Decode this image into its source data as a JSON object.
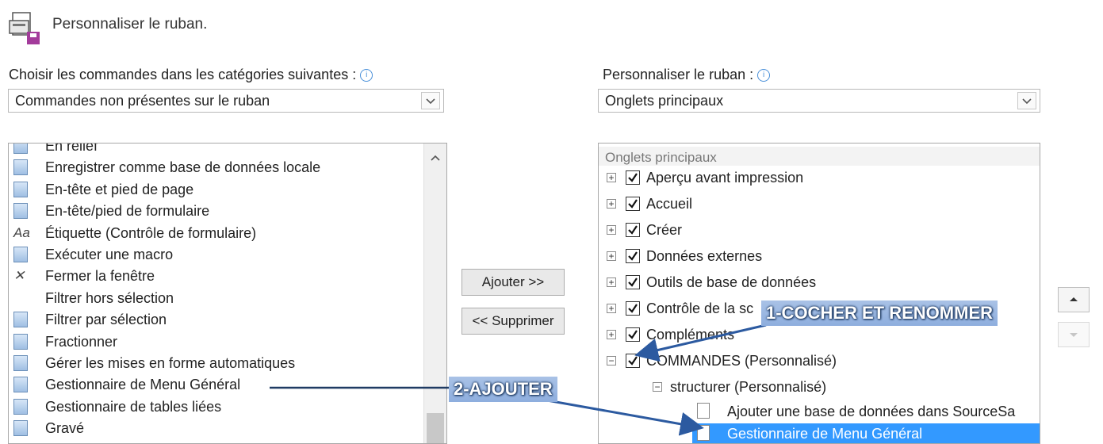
{
  "header": {
    "title": "Personnaliser le ruban."
  },
  "left": {
    "label": "Choisir les commandes dans les catégories suivantes :",
    "combo_value": "Commandes non présentes sur le ruban",
    "items": [
      {
        "label": "En relief",
        "icon": "emboss-icon"
      },
      {
        "label": "Enregistrer comme base de données locale",
        "icon": "save-local-db-icon"
      },
      {
        "label": "En-tête et pied de page",
        "icon": "header-footer-icon"
      },
      {
        "label": "En-tête/pied de formulaire",
        "icon": "form-header-icon"
      },
      {
        "label": "Étiquette (Contrôle de formulaire)",
        "icon": "label-aa-icon",
        "glyph": "Aa"
      },
      {
        "label": "Exécuter une macro",
        "icon": "run-macro-icon"
      },
      {
        "label": "Fermer la fenêtre",
        "icon": "close-icon",
        "glyph": "✕"
      },
      {
        "label": "Filtrer hors sélection",
        "icon": ""
      },
      {
        "label": "Filtrer par sélection",
        "icon": "filter-icon"
      },
      {
        "label": "Fractionner",
        "icon": "split-window-icon"
      },
      {
        "label": "Gérer les mises en forme automatiques",
        "icon": "autoformat-icon"
      },
      {
        "label": "Gestionnaire de Menu Général",
        "icon": "switchboard-icon"
      },
      {
        "label": "Gestionnaire de tables liées",
        "icon": "linked-table-icon"
      },
      {
        "label": "Gravé",
        "icon": "engrave-icon"
      }
    ]
  },
  "middle": {
    "add_label": "Ajouter >>",
    "remove_label": "<< Supprimer"
  },
  "right": {
    "label": "Personnaliser le ruban :",
    "combo_value": "Onglets principaux",
    "tree_header": "Onglets principaux",
    "tabs": [
      {
        "label": "Aperçu avant impression",
        "checked": true,
        "expander": "+"
      },
      {
        "label": "Accueil",
        "checked": true,
        "expander": "+"
      },
      {
        "label": "Créer",
        "checked": true,
        "expander": "+"
      },
      {
        "label": "Données externes",
        "checked": true,
        "expander": "+"
      },
      {
        "label": "Outils de base de données",
        "checked": true,
        "expander": "+"
      },
      {
        "label": "Contrôle de la sc",
        "checked": true,
        "expander": "+"
      },
      {
        "label": "Compléments",
        "checked": true,
        "expander": "+"
      },
      {
        "label": "COMMANDES (Personnalisé)",
        "checked": true,
        "expander": "−"
      }
    ],
    "group": {
      "label": "structurer (Personnalisé)",
      "expander": "−"
    },
    "commands": [
      {
        "label": "Ajouter une base de données dans SourceSa",
        "selected": false
      },
      {
        "label": "Gestionnaire de Menu Général",
        "selected": true
      }
    ]
  },
  "annotations": {
    "step1": "1-COCHER ET RENOMMER",
    "step2": "2-AJOUTER"
  },
  "colors": {
    "selection": "#3399ff",
    "arrow": "#2c5aa0",
    "callout_bg": "#9bb7e1"
  }
}
